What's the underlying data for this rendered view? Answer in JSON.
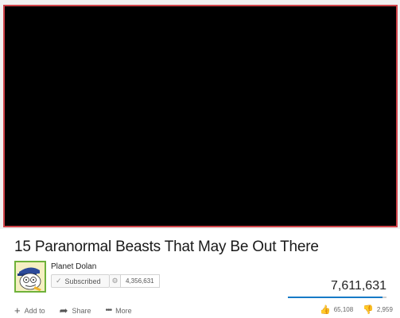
{
  "video": {
    "title": "15 Paranormal Beasts That May Be Out There",
    "views": "7,611,631",
    "like_ratio": 0.957
  },
  "channel": {
    "name": "Planet Dolan",
    "subscribe_label": "Subscribed",
    "subscriber_count": "4,356,631"
  },
  "actions": {
    "add_to_label": "Add to",
    "share_label": "Share",
    "more_label": "More"
  },
  "ratings": {
    "likes": "65,108",
    "dislikes": "2,959"
  },
  "colors": {
    "player_border": "#d0444a",
    "sentiment_fill": "#167ac6",
    "avatar_border": "#6fb23a"
  },
  "icons": [
    "plus-icon",
    "share-arrow-icon",
    "more-dots-icon",
    "thumbs-up-icon",
    "thumbs-down-icon",
    "check-icon",
    "gear-icon"
  ]
}
